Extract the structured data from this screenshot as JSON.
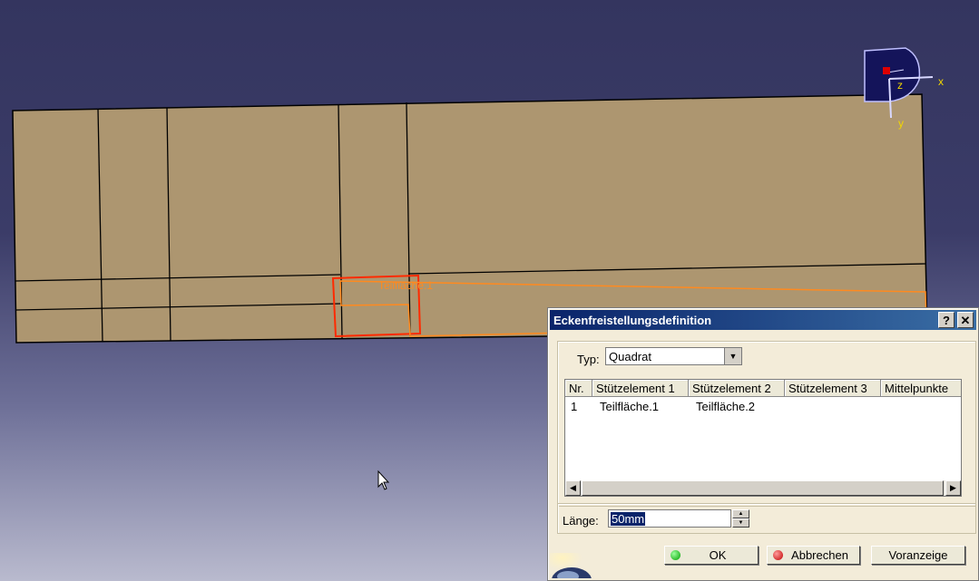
{
  "viewport": {
    "surface_label": "Teilfläche.1",
    "compass": {
      "x_label": "x",
      "y_label": "y",
      "z_label": "z"
    }
  },
  "dialog": {
    "title": "Eckenfreistellungsdefinition",
    "help_label": "?",
    "close_label": "✕",
    "type_label": "Typ:",
    "type_value": "Quadrat",
    "table": {
      "columns": [
        "Nr.",
        "Stützelement 1",
        "Stützelement 2",
        "Stützelement 3",
        "Mittelpunkte"
      ],
      "rows": [
        [
          "1",
          "Teilfläche.1",
          "Teilfläche.2",
          "",
          ""
        ]
      ]
    },
    "length_label": "Länge:",
    "length_value": "50mm",
    "buttons": {
      "ok": "OK",
      "cancel": "Abbrechen",
      "preview": "Voranzeige"
    }
  },
  "colors": {
    "surface": "#ad9670",
    "background_top": "#34355f",
    "highlight_red": "#ff2a00",
    "highlight_orange": "#ff8a1f",
    "titlebar": "#0a246a"
  }
}
